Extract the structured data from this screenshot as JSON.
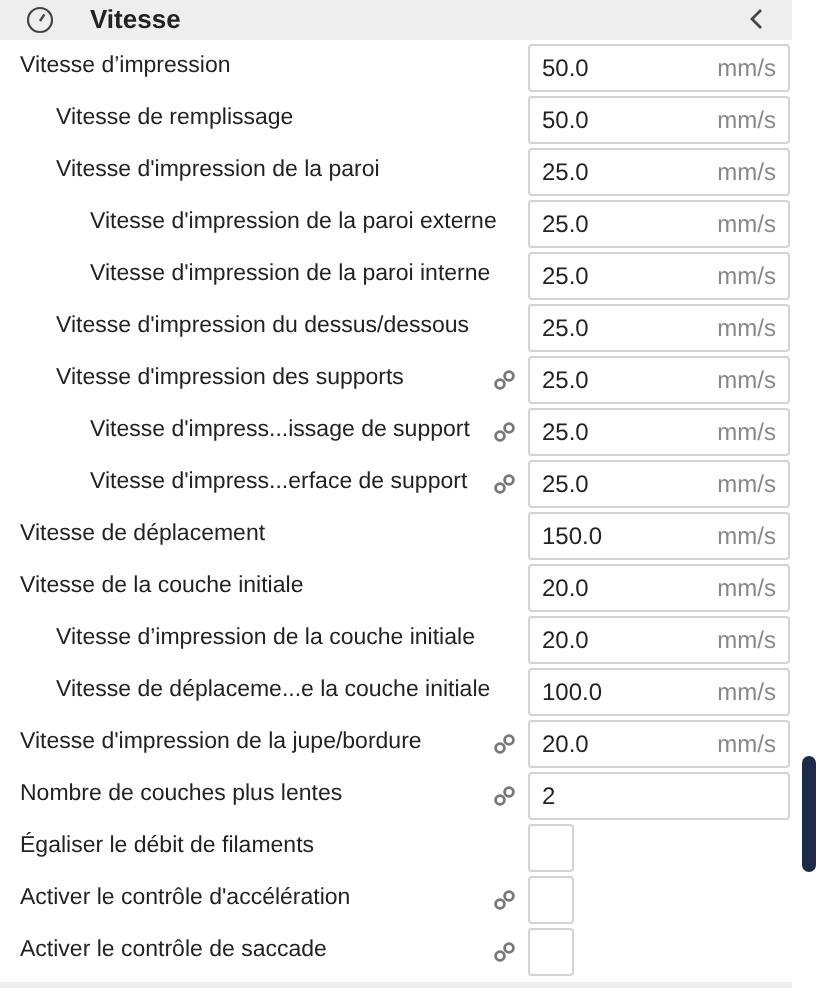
{
  "panel": {
    "title": "Vitesse"
  },
  "settings": [
    {
      "label": "Vitesse d’impression",
      "kind": "number",
      "value": "50.0",
      "unit": "mm/s",
      "linked": false,
      "children": [
        {
          "label": "Vitesse de remplissage",
          "kind": "number",
          "value": "50.0",
          "unit": "mm/s",
          "linked": false
        },
        {
          "label": "Vitesse d'impression de la paroi",
          "kind": "number",
          "value": "25.0",
          "unit": "mm/s",
          "linked": false,
          "children": [
            {
              "label": "Vitesse d'impression de la paroi externe",
              "kind": "number",
              "value": "25.0",
              "unit": "mm/s",
              "linked": false
            },
            {
              "label": "Vitesse d'impression de la paroi interne",
              "kind": "number",
              "value": "25.0",
              "unit": "mm/s",
              "linked": false
            }
          ]
        },
        {
          "label": "Vitesse d'impression du dessus/dessous",
          "kind": "number",
          "value": "25.0",
          "unit": "mm/s",
          "linked": false
        },
        {
          "label": "Vitesse d'impression des supports",
          "kind": "number",
          "value": "25.0",
          "unit": "mm/s",
          "linked": true,
          "children": [
            {
              "label": "Vitesse d'impress...issage de support",
              "kind": "number",
              "value": "25.0",
              "unit": "mm/s",
              "linked": true
            },
            {
              "label": "Vitesse d'impress...erface de support",
              "kind": "number",
              "value": "25.0",
              "unit": "mm/s",
              "linked": true
            }
          ]
        }
      ]
    },
    {
      "label": "Vitesse de déplacement",
      "kind": "number",
      "value": "150.0",
      "unit": "mm/s",
      "linked": false
    },
    {
      "label": "Vitesse de la couche initiale",
      "kind": "number",
      "value": "20.0",
      "unit": "mm/s",
      "linked": false,
      "children": [
        {
          "label": "Vitesse d’impression de la couche initiale",
          "kind": "number",
          "value": "20.0",
          "unit": "mm/s",
          "linked": false
        },
        {
          "label": "Vitesse de déplaceme...e la couche initiale",
          "kind": "number",
          "value": "100.0",
          "unit": "mm/s",
          "linked": false
        }
      ]
    },
    {
      "label": "Vitesse d'impression de la jupe/bordure",
      "kind": "number",
      "value": "20.0",
      "unit": "mm/s",
      "linked": true
    },
    {
      "label": "Nombre de couches plus lentes",
      "kind": "text",
      "value": "2",
      "linked": true
    },
    {
      "label": "Égaliser le débit de filaments",
      "kind": "checkbox",
      "checked": false,
      "linked": false
    },
    {
      "label": "Activer le contrôle d'accélération",
      "kind": "checkbox",
      "checked": false,
      "linked": true
    },
    {
      "label": "Activer le contrôle de saccade",
      "kind": "checkbox",
      "checked": false,
      "linked": true
    }
  ]
}
